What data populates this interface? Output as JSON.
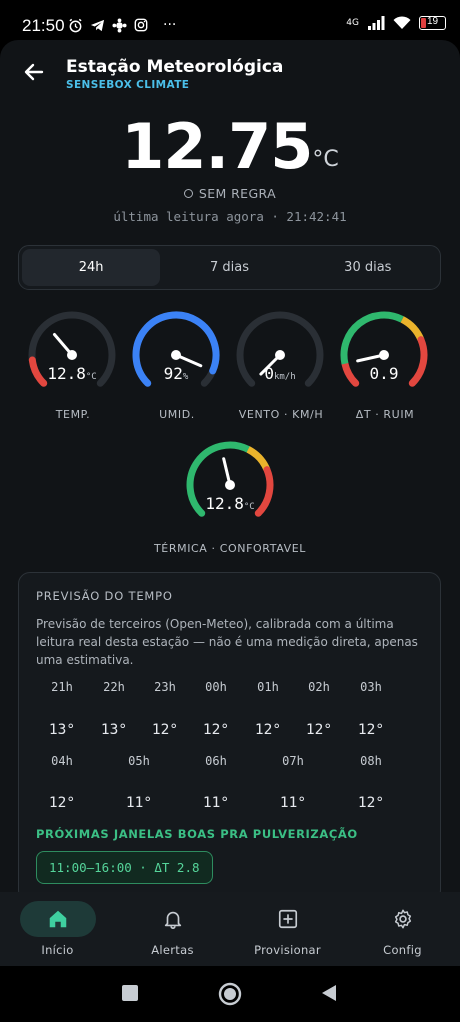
{
  "status": {
    "time": "21:50",
    "icons": [
      "alarm-icon",
      "telegram-icon",
      "gear-flower-icon",
      "instagram-icon",
      "more-icon"
    ],
    "more": "···",
    "network": "4G",
    "battery": "19"
  },
  "header": {
    "title": "Estação Meteorológica",
    "subtitle": "SENSEBOX CLIMATE"
  },
  "reading": {
    "temperature": "12.75",
    "unit": "°C",
    "rule": "SEM REGRA",
    "last_reading": "última leitura agora · 21:42:41"
  },
  "tabs": [
    {
      "label": "24h",
      "active": true
    },
    {
      "label": "7 dias",
      "active": false
    },
    {
      "label": "30 dias",
      "active": false
    }
  ],
  "gauges": [
    {
      "label": "TEMP.",
      "value": "12.8",
      "unit": "°C",
      "fraction": 0.35
    },
    {
      "label": "UMID.",
      "value": "92",
      "unit": "%",
      "fraction": 0.92
    },
    {
      "label": "VENTO · KM/H",
      "value": "0",
      "unit": "km/h",
      "fraction": 0.0
    },
    {
      "label": "ΔT · RUIM",
      "value": "0.9",
      "unit": "",
      "fraction": 0.12
    },
    {
      "label": "TÉRMICA · CONFORTAVEL",
      "value": "12.8",
      "unit": "°C",
      "fraction": 0.45
    }
  ],
  "colors": {
    "accent": "#4bbfe9",
    "humidity": "#3b82f6",
    "red": "#e2473f",
    "yellow": "#eab32c",
    "green": "#2fb86e",
    "track": "#2a2f35"
  },
  "forecast": {
    "title": "PREVISÃO DO TEMPO",
    "description": "Previsão de terceiros (Open-Meteo), calibrada com a última leitura real desta estação — não é uma medição direta, apenas uma estimativa.",
    "row1": [
      {
        "hour": "21h",
        "temp": "13°"
      },
      {
        "hour": "22h",
        "temp": "13°"
      },
      {
        "hour": "23h",
        "temp": "12°"
      },
      {
        "hour": "00h",
        "temp": "12°"
      },
      {
        "hour": "01h",
        "temp": "12°"
      },
      {
        "hour": "02h",
        "temp": "12°"
      },
      {
        "hour": "03h",
        "temp": "12°"
      }
    ],
    "row2": [
      {
        "hour": "04h",
        "temp": "12°"
      },
      {
        "hour": "05h",
        "temp": "11°"
      },
      {
        "hour": "06h",
        "temp": "11°"
      },
      {
        "hour": "07h",
        "temp": "11°"
      },
      {
        "hour": "08h",
        "temp": "12°"
      }
    ],
    "spray_title": "PRÓXIMAS JANELAS BOAS PRA PULVERIZAÇÃO",
    "spray_window": "11:00–16:00 · ΔT 2.8"
  },
  "nav": [
    {
      "label": "Início",
      "icon": "home-icon",
      "active": true
    },
    {
      "label": "Alertas",
      "icon": "bell-icon",
      "active": false
    },
    {
      "label": "Provisionar",
      "icon": "add-box-icon",
      "active": false
    },
    {
      "label": "Config",
      "icon": "gear-icon",
      "active": false
    }
  ]
}
